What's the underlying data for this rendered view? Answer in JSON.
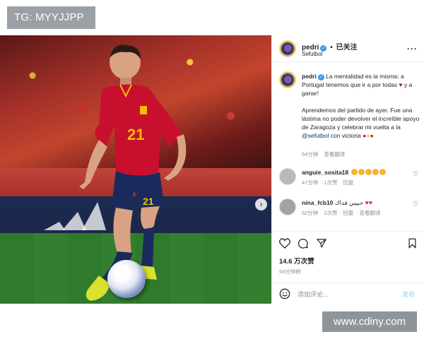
{
  "watermark_top": "TG: MYYJJPP",
  "watermark_bottom": "www.cdiny.com",
  "post": {
    "author": {
      "username": "pedri",
      "follow_status": "已关注",
      "subtitle": "Sefutbol"
    },
    "caption": {
      "username": "pedri",
      "line1": "La mentalidad es la misma: a Portugal tenemos que ir a por todas",
      "line1_end": "y a ganar!",
      "line2": "Aprendemos del partido de ayer. Fue una lástima no poder devolver el increíble apoyo de Zaragoza y celebrar mi vuelta a la",
      "mention": "@sefutbol",
      "line2_end": "con victoria",
      "time": "54分钟",
      "translate": "查看翻译"
    },
    "comments": [
      {
        "username": "anguie_sosita18",
        "text": "",
        "time": "47分钟",
        "likes": "1次赞",
        "reply": "回复"
      },
      {
        "username": "nina_fcb10",
        "text": "حبيبي فداك",
        "time": "52分钟",
        "likes": "2次赞",
        "reply": "回复",
        "translate": "查看翻译"
      }
    ],
    "likes": "14.6 万次赞",
    "date": "54分钟前",
    "add_comment": {
      "placeholder": "添加评论...",
      "post_label": "发布"
    },
    "carousel": {
      "slides": 2,
      "active": 1
    },
    "colors": {
      "accent": "#0095f6",
      "verified": "#3897f0",
      "heart": "#e0245e"
    },
    "icons": [
      "heart-icon",
      "comment-icon",
      "share-icon",
      "bookmark-icon",
      "emoji-icon",
      "more-icon",
      "verified-icon",
      "chevron-right-icon",
      "user-tag-icon"
    ]
  }
}
